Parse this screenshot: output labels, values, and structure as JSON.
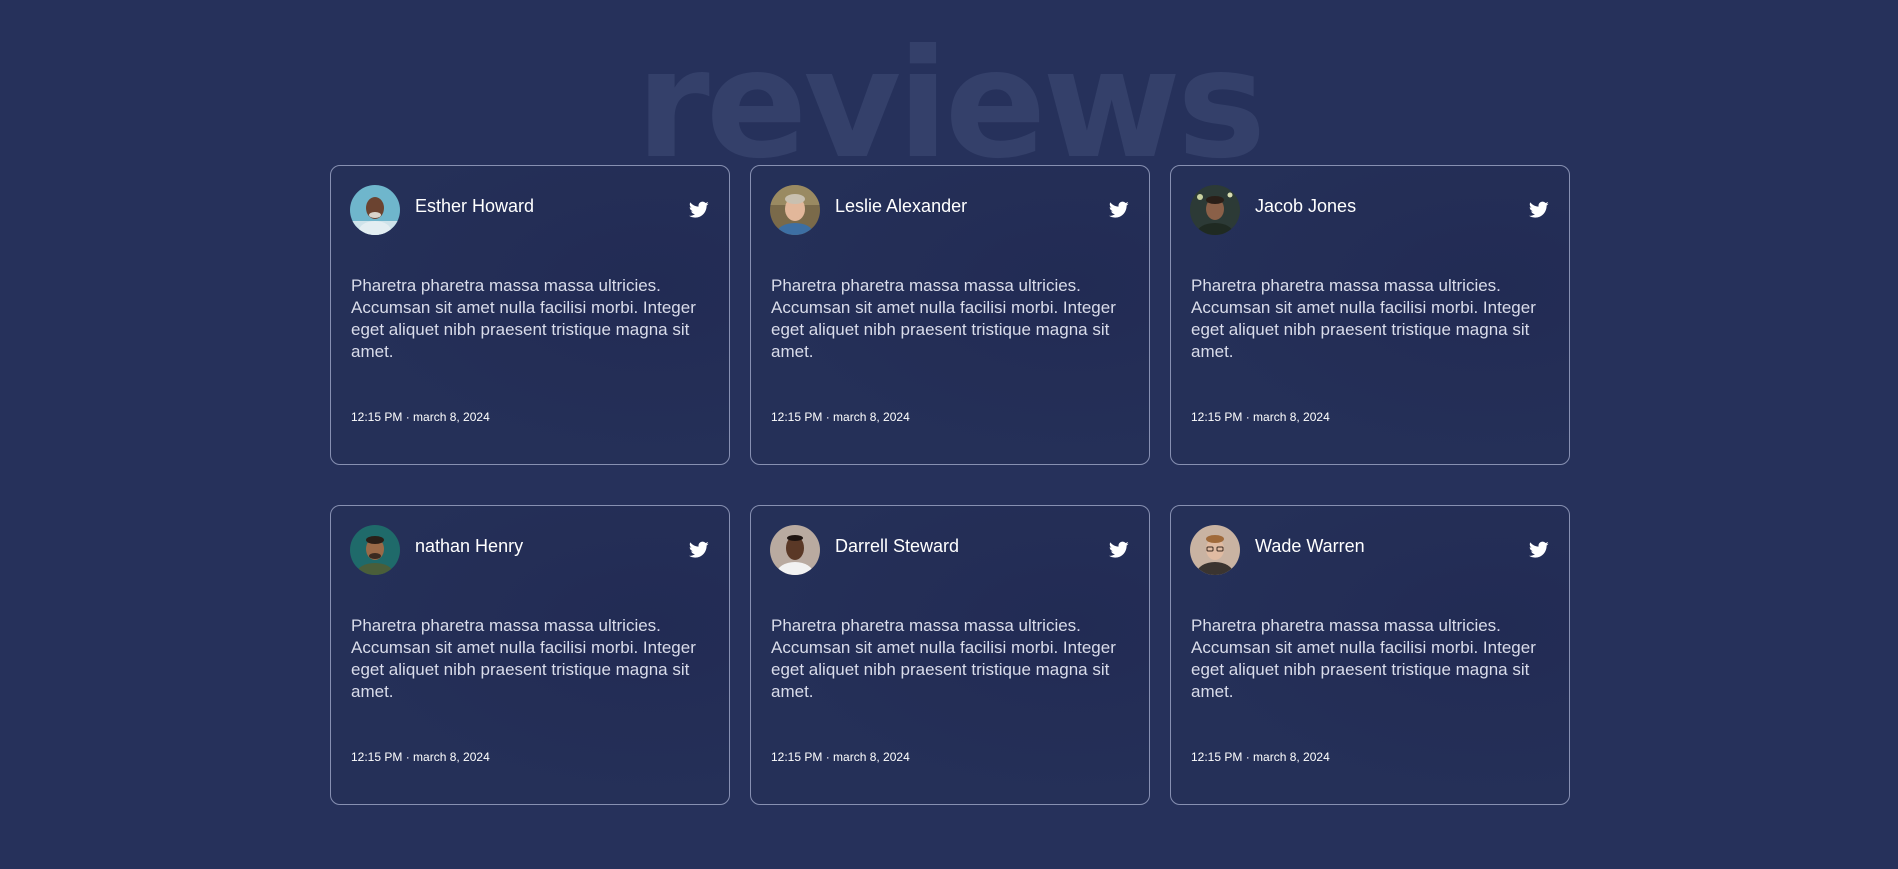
{
  "page": {
    "watermark": "reviews"
  },
  "colors": {
    "background": "#26315b",
    "card_border": "#8790b2",
    "text_primary": "#ffffff",
    "text_body": "#d9dcea"
  },
  "reviews": [
    {
      "name": "Esther Howard",
      "text": "Pharetra pharetra massa massa ultricies. Accumsan sit amet nulla facilisi morbi. Integer eget aliquet nibh praesent tristique magna sit amet.",
      "time": "12:15 PM · march 8, 2024",
      "icon": "twitter-icon"
    },
    {
      "name": "Leslie Alexander",
      "text": "Pharetra pharetra massa massa ultricies. Accumsan sit amet nulla facilisi morbi. Integer eget aliquet nibh praesent tristique magna sit amet.",
      "time": "12:15 PM · march 8, 2024",
      "icon": "twitter-icon"
    },
    {
      "name": "Jacob Jones",
      "text": "Pharetra pharetra massa massa ultricies. Accumsan sit amet nulla facilisi morbi. Integer eget aliquet nibh praesent tristique magna sit amet.",
      "time": "12:15 PM · march 8, 2024",
      "icon": "twitter-icon"
    },
    {
      "name": "nathan Henry",
      "text": "Pharetra pharetra massa massa ultricies. Accumsan sit amet nulla facilisi morbi. Integer eget aliquet nibh praesent tristique magna sit amet.",
      "time": "12:15 PM · march 8, 2024",
      "icon": "twitter-icon"
    },
    {
      "name": "Darrell Steward",
      "text": "Pharetra pharetra massa massa ultricies. Accumsan sit amet nulla facilisi morbi. Integer eget aliquet nibh praesent tristique magna sit amet.",
      "time": "12:15 PM · march 8, 2024",
      "icon": "twitter-icon"
    },
    {
      "name": "Wade Warren",
      "text": "Pharetra pharetra massa massa ultricies. Accumsan sit amet nulla facilisi morbi. Integer eget aliquet nibh praesent tristique magna sit amet.",
      "time": "12:15 PM · march 8, 2024",
      "icon": "twitter-icon"
    }
  ]
}
